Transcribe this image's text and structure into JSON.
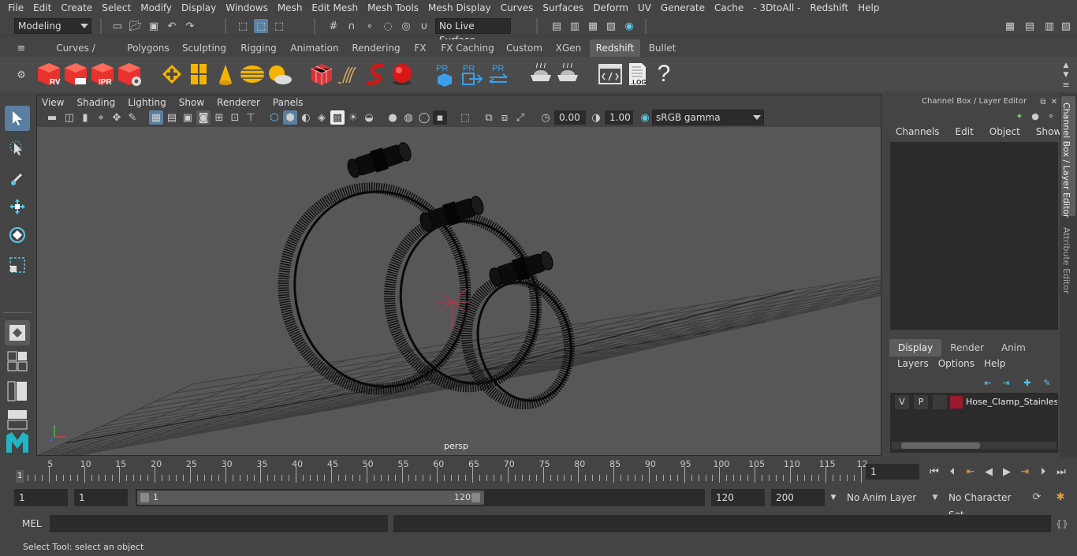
{
  "menubar": {
    "items": [
      "File",
      "Edit",
      "Create",
      "Select",
      "Modify",
      "Display",
      "Windows",
      "Mesh",
      "Edit Mesh",
      "Mesh Tools",
      "Mesh Display",
      "Curves",
      "Surfaces",
      "Deform",
      "UV",
      "Generate",
      "Cache",
      "- 3DtoAll -",
      "Redshift",
      "Help"
    ]
  },
  "statusline": {
    "mode": "Modeling",
    "live_surface": "No Live Surface"
  },
  "shelf": {
    "tabs": [
      "Curves / Surfaces",
      "Polygons",
      "Sculpting",
      "Rigging",
      "Animation",
      "Rendering",
      "FX",
      "FX Caching",
      "Custom",
      "XGen",
      "Redshift",
      "Bullet"
    ],
    "active_tab": "Redshift",
    "icon_labels": {
      "rv": "RV",
      "ipr": "IPR",
      "pr": "PR",
      "log": ".LOG",
      "help": "?"
    }
  },
  "viewport": {
    "menus": [
      "View",
      "Shading",
      "Lighting",
      "Show",
      "Renderer",
      "Panels"
    ],
    "exposure": "0.00",
    "gamma": "1.00",
    "colorspace": "sRGB gamma",
    "camera_label": "persp"
  },
  "channel_box": {
    "title": "Channel Box / Layer Editor",
    "menus": [
      "Channels",
      "Edit",
      "Object",
      "Show"
    ],
    "layer_tabs": [
      "Display",
      "Render",
      "Anim"
    ],
    "active_layer_tab": "Display",
    "layer_menus": [
      "Layers",
      "Options",
      "Help"
    ],
    "layer": {
      "v": "V",
      "p": "P",
      "name": "Hose_Clamp_Stainless",
      "color": "#9c1a2e"
    }
  },
  "side_tabs": [
    "Channel Box / Layer Editor",
    "Attribute Editor"
  ],
  "timeline": {
    "ticks": [
      "5",
      "10",
      "15",
      "20",
      "25",
      "30",
      "35",
      "40",
      "45",
      "50",
      "55",
      "60",
      "65",
      "70",
      "75",
      "80",
      "85",
      "90",
      "95",
      "100",
      "105",
      "110",
      "115",
      "12"
    ],
    "start_marker": "1",
    "current_frame": "1"
  },
  "range": {
    "start": "1",
    "anim_start": "1",
    "slider_start": "1",
    "slider_end": "120",
    "anim_end": "120",
    "end": "200",
    "anim_layer": "No Anim Layer",
    "char_set": "No Character Set"
  },
  "cmdline": {
    "label": "MEL"
  },
  "help": {
    "text": "Select Tool: select an object"
  }
}
